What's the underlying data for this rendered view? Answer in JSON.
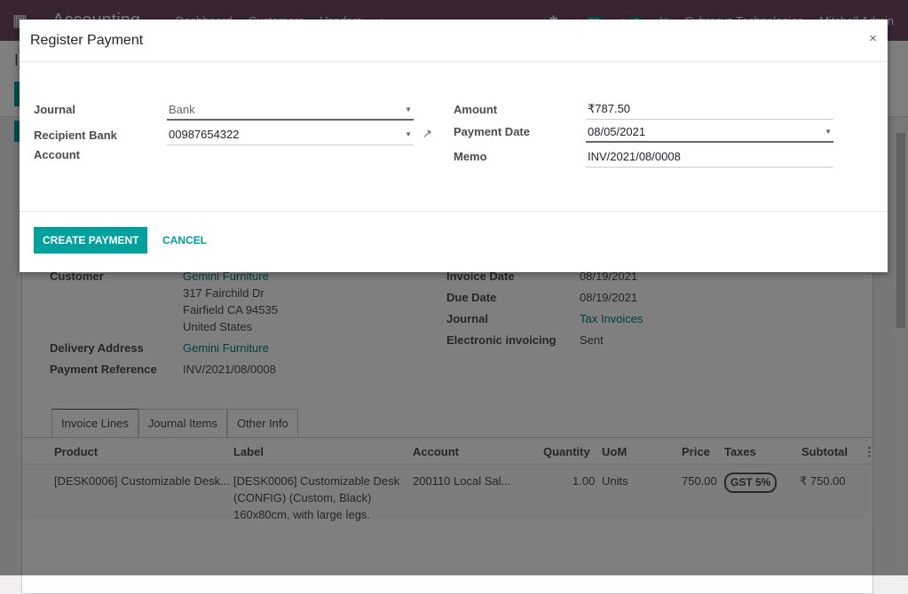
{
  "navbar": {
    "app": "Accounting",
    "menu": [
      "Dashboard",
      "Customers",
      "Vendors",
      "+"
    ],
    "activity_count": "58",
    "message_count": "6",
    "company": "Cybrosys Technologies",
    "user": "Mitchell Admin"
  },
  "invoice": {
    "customer_label": "Customer",
    "customer": "Gemini Furniture",
    "address": [
      "317 Fairchild Dr",
      "Fairfield CA 94535",
      "United States"
    ],
    "delivery_label": "Delivery Address",
    "delivery": "Gemini Furniture",
    "payref_label": "Payment Reference",
    "payref": "INV/2021/08/0008",
    "invoice_date_label": "Invoice Date",
    "invoice_date": "08/19/2021",
    "due_date_label": "Due Date",
    "due_date": "08/19/2021",
    "journal_label": "Journal",
    "journal": "Tax Invoices",
    "einv_label": "Electronic invoicing",
    "einv": "Sent",
    "tabs": [
      "Invoice Lines",
      "Journal Items",
      "Other Info"
    ],
    "columns": [
      "Product",
      "Label",
      "Account",
      "Quantity",
      "UoM",
      "Price",
      "Taxes",
      "Subtotal"
    ],
    "lines": [
      {
        "product": "[DESK0006] Customizable Desk...",
        "label": [
          "[DESK0006] Customizable Desk",
          "(CONFIG) (Custom, Black)",
          "160x80cm, with large legs."
        ],
        "account": "200110 Local Sal...",
        "quantity": "1.00",
        "uom": "Units",
        "price": "750.00",
        "taxes": "GST 5%",
        "subtotal": "₹ 750.00"
      }
    ]
  },
  "modal": {
    "title": "Register Payment",
    "close": "×",
    "journal_label": "Journal",
    "journal": "Bank",
    "recipient_label": "Recipient Bank Account",
    "recipient": "00987654322",
    "amount_label": "Amount",
    "amount": "₹787.50",
    "date_label": "Payment Date",
    "date": "08/05/2021",
    "memo_label": "Memo",
    "memo": "INV/2021/08/0008",
    "create_label": "CREATE PAYMENT",
    "cancel_label": "CANCEL"
  }
}
